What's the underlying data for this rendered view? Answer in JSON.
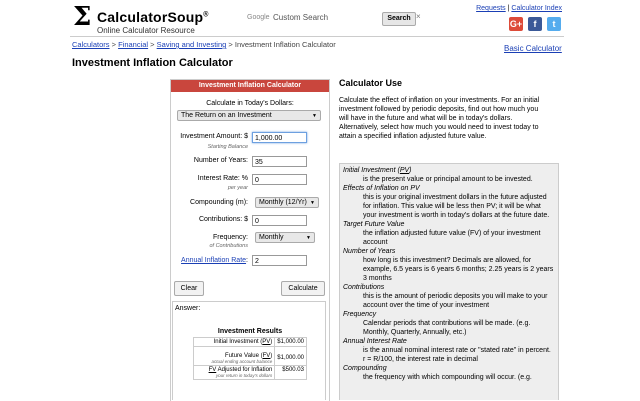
{
  "header": {
    "logo_symbol": "Σ",
    "logo_name": "CalculatorSoup",
    "logo_reg": "®",
    "logo_tagline": "Online Calculator Resource",
    "search_brand": "Google",
    "search_placeholder": "Custom Search",
    "search_button": "Search",
    "search_clear": "×",
    "links": {
      "requests": "Requests",
      "sep": " | ",
      "index": "Calculator Index"
    },
    "social": [
      {
        "name": "google-plus",
        "label": "G+",
        "color": "#dd4b39"
      },
      {
        "name": "facebook",
        "label": "f",
        "color": "#3b5998"
      },
      {
        "name": "twitter",
        "label": "t",
        "color": "#55acee"
      }
    ]
  },
  "breadcrumb": {
    "items": [
      "Calculators",
      "Financial",
      "Saving and Investing"
    ],
    "current": "Investment Inflation Calculator",
    "sep": " > "
  },
  "basic_link": "Basic Calculator",
  "page_title": "Investment Inflation Calculator",
  "calculator": {
    "title": "Investment Inflation Calculator",
    "calc_in_label": "Calculate in Today's Dollars:",
    "calc_in_value": "The Return on an Investment",
    "investment_label": "Investment Amount: $",
    "investment_value": "1,000.00",
    "investment_sub": "Starting Balance",
    "years_label": "Number of Years:",
    "years_value": "35",
    "rate_label": "Interest Rate: %",
    "rate_value": "0",
    "rate_sub": "per year",
    "compounding_label": "Compounding (m):",
    "compounding_value": "Monthly (12/Yr)",
    "contributions_label": "Contributions: $",
    "contributions_value": "0",
    "frequency_label": "Frequency:",
    "frequency_value": "Monthly",
    "frequency_sub": "of Contributions",
    "inflation_label": "Annual Inflation Rate",
    "inflation_colon": ":",
    "inflation_value": "2",
    "clear_button": "Clear",
    "calculate_button": "Calculate",
    "arrow": "▼"
  },
  "answer": {
    "label": "Answer:",
    "results_title": "Investment Results",
    "rows": [
      {
        "key_pre": "Initial Investment (",
        "key_abbr": "PV",
        "key_post": ")",
        "sub": "",
        "value": "$1,000.00"
      },
      {
        "key_pre": "Future Value (",
        "key_abbr": "FV",
        "key_post": ")",
        "sub": "actual ending account balance",
        "value": "$1,000.00"
      },
      {
        "key_pre": "",
        "key_abbr": "FV",
        "key_post": " Adjusted for Inflation",
        "sub": "your return in today's dollars",
        "value": "$500.03"
      }
    ]
  },
  "calculator_use": {
    "title": "Calculator Use",
    "intro": "Calculate the effect of inflation on your investments. For an initial investment followed by periodic deposits, find out how much you will have in the future and what will be in today's dollars. Alternatively, select how much you would need to invest today to attain a specified inflation adjusted future value.",
    "definitions": [
      {
        "term_pre": "Initial Investment (",
        "term_abbr": "PV",
        "term_post": ")",
        "desc": "is the present value or principal amount to be invested."
      },
      {
        "term_pre": "Effects of Inflation on PV",
        "term_abbr": "",
        "term_post": "",
        "desc": "this is your original investment dollars in the future adjusted for inflation. This value will be less then PV; it will be what your investment is worth in today's dollars at the future date."
      },
      {
        "term_pre": "Target Future Value",
        "term_abbr": "",
        "term_post": "",
        "desc": "the inflation adjusted future value (FV) of your investment account"
      },
      {
        "term_pre": "Number of Years",
        "term_abbr": "",
        "term_post": "",
        "desc": "how long is this investment? Decimals are allowed, for example, 6.5 years is 6 years 6 months; 2.25 years is 2 years 3 months"
      },
      {
        "term_pre": "Contributions",
        "term_abbr": "",
        "term_post": "",
        "desc": "this is the amount of periodic deposits you will make to your account over the time of your investment"
      },
      {
        "term_pre": "Frequency",
        "term_abbr": "",
        "term_post": "",
        "desc": "Calendar periods that contributions will be made. (e.g. Monthly, Quarterly, Annually, etc.)"
      },
      {
        "term_pre": "Annual Interest Rate",
        "term_abbr": "",
        "term_post": "",
        "desc": "is the annual nominal interest rate or \"stated rate\" in percent. r = R/100, the interest rate in decimal"
      },
      {
        "term_pre": "Compounding",
        "term_abbr": "",
        "term_post": "",
        "desc": "the frequency with which compounding will occur. (e.g."
      }
    ]
  }
}
